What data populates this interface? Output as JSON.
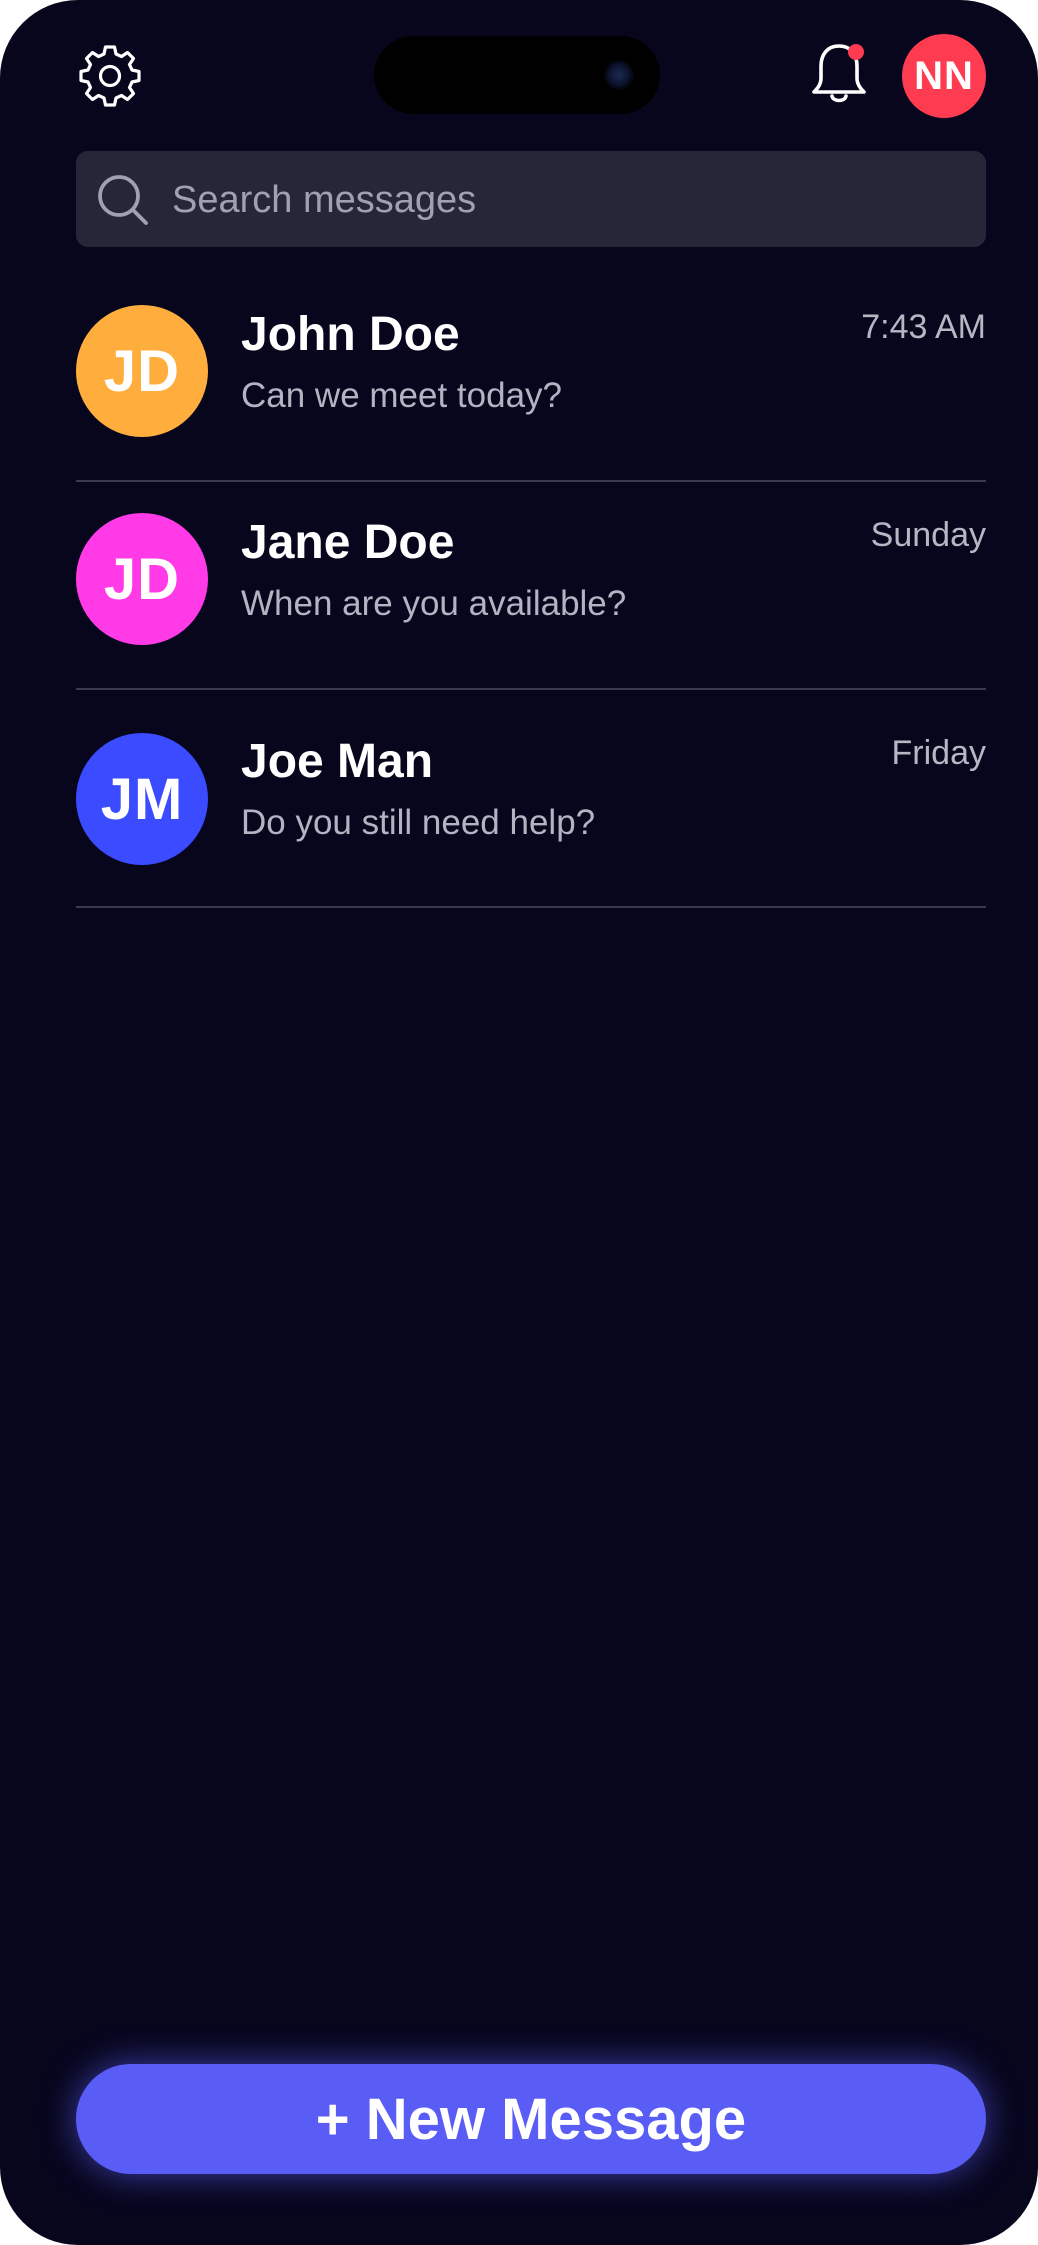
{
  "header": {
    "settings_icon": "gear-icon",
    "notifications_icon": "bell-icon",
    "has_unread_notification": true,
    "user_initials": "NN",
    "user_avatar_color": "#ff3b52"
  },
  "search": {
    "placeholder": "Search messages",
    "value": ""
  },
  "conversations": [
    {
      "initials": "JD",
      "name": "John Doe",
      "preview": "Can we meet today?",
      "time": "7:43 AM",
      "color": "#ffad3d"
    },
    {
      "initials": "JD",
      "name": "Jane Doe",
      "preview": "When are you available?",
      "time": "Sunday",
      "color": "#ff3ae6"
    },
    {
      "initials": "JM",
      "name": "Joe Man",
      "preview": "Do you still need help?",
      "time": "Friday",
      "color": "#3b4bff"
    }
  ],
  "new_message_button": {
    "label": "+ New Message",
    "color": "#5a5cf6"
  },
  "colors": {
    "background": "#07061d",
    "search_background": "#272638",
    "divider": "#3a3a4c"
  }
}
